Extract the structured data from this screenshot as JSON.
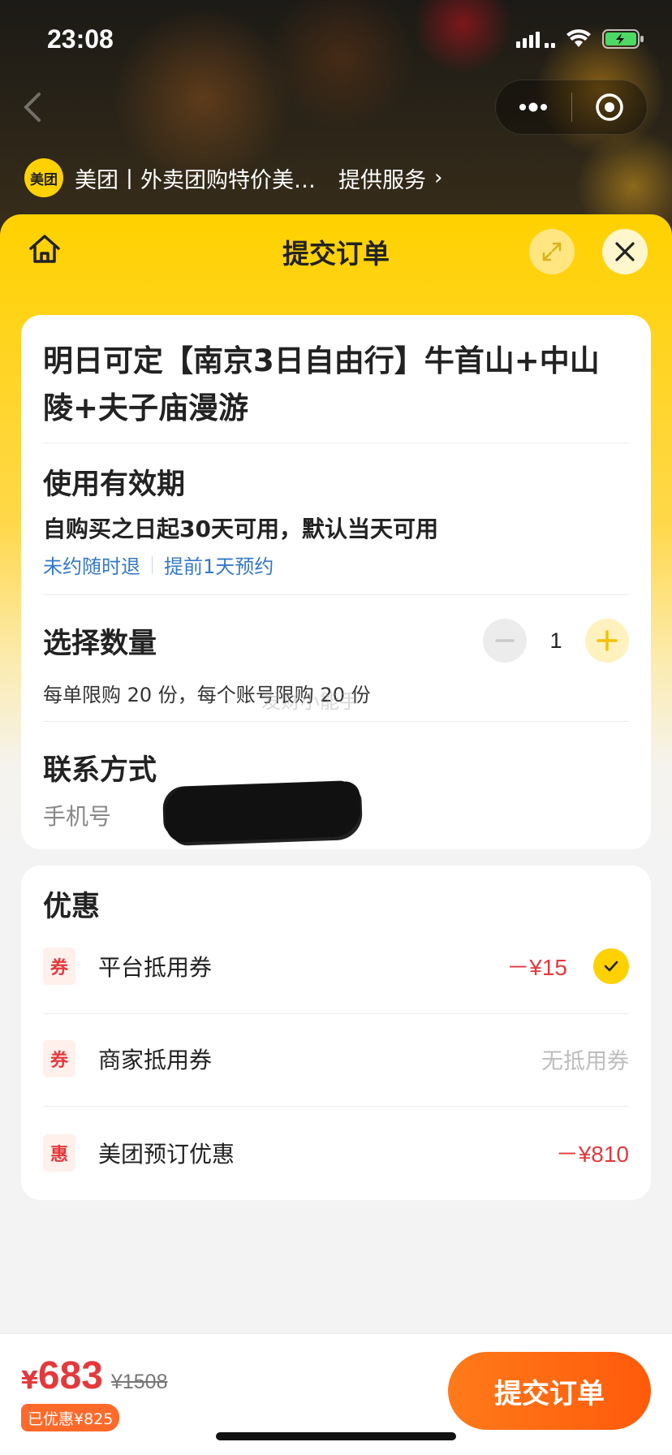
{
  "status_bar": {
    "time": "23:08"
  },
  "service": {
    "logo_text": "美团",
    "name": "美团丨外卖团购特价美…",
    "provide_label": "提供服务",
    "chevron": "›"
  },
  "sheet": {
    "title": "提交订单"
  },
  "product": {
    "title": "明日可定【南京3日自由行】牛首山+中山陵+夫子庙漫游"
  },
  "validity": {
    "title": "使用有效期",
    "text": "自购买之日起30天可用，默认当天可用",
    "tags": [
      "未约随时退",
      "提前1天预约"
    ]
  },
  "quantity": {
    "title": "选择数量",
    "value": "1",
    "limit_text": "每单限购 20 份，每个账号限购 20 份",
    "watermark": "发财小能手"
  },
  "contact": {
    "title": "联系方式",
    "phone_label": "手机号"
  },
  "discounts": {
    "title": "优惠",
    "rows": [
      {
        "badge": "券",
        "label": "平台抵用券",
        "value": "－¥15",
        "checked": true
      },
      {
        "badge": "券",
        "label": "商家抵用券",
        "value": "无抵用券",
        "checked": false
      },
      {
        "badge": "惠",
        "label": "美团预订优惠",
        "value": "－¥810",
        "checked": false
      }
    ]
  },
  "bottom": {
    "currency": "¥",
    "price": "683",
    "original_price": "¥1508",
    "saved": "已优惠¥825",
    "submit_label": "提交订单"
  },
  "colors": {
    "brand_yellow": "#ffd100",
    "price_red": "#e4393c",
    "link_blue": "#3479c8",
    "submit_orange": "#ff6a1a"
  }
}
